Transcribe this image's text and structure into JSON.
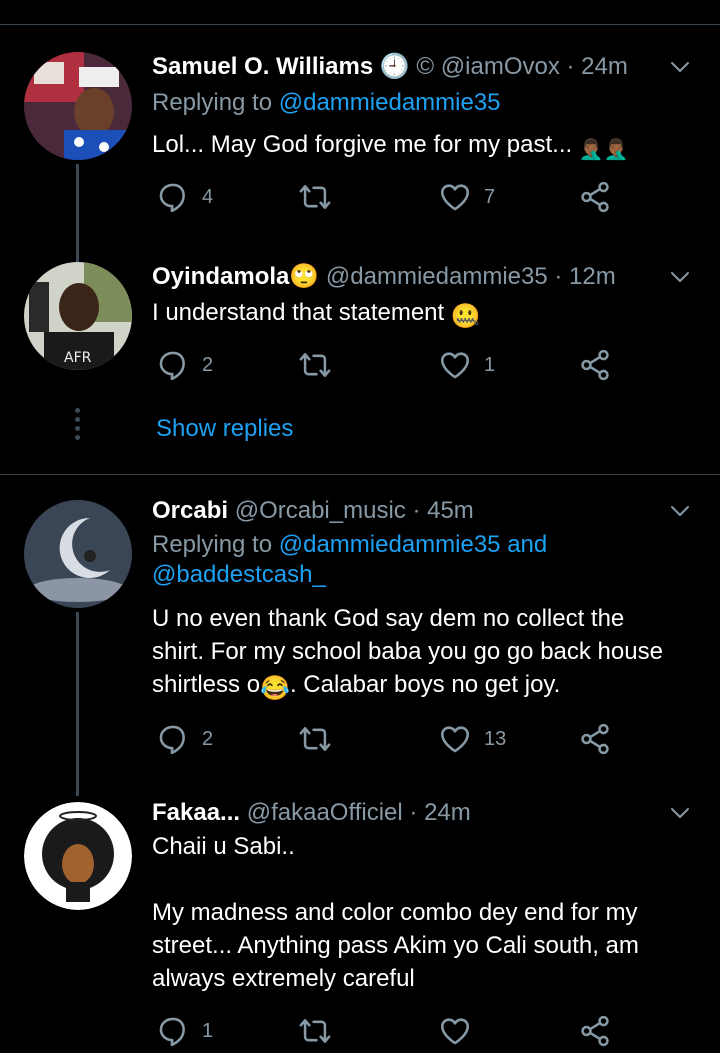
{
  "tweets": [
    {
      "name": "Samuel O. Williams",
      "name_suffix": "🕘 ©",
      "handle": "@iamOvox",
      "time": "· 24m",
      "replying_prefix": "Replying to ",
      "replying_to": "@dammiedammie35",
      "text": "Lol... May God forgive me for my past...",
      "text_emoji": "🤦🏾‍♂️🤦🏾‍♂️",
      "replies": "4",
      "retweets": "",
      "likes": "7"
    },
    {
      "name": "Oyindamola🙄",
      "handle": "@dammiedammie35",
      "time": "· 12m",
      "text": "I understand that statement",
      "text_emoji": "🤐",
      "replies": "2",
      "retweets": "",
      "likes": "1"
    },
    {
      "name": "Orcabi",
      "handle": "@Orcabi_music",
      "time": "· 45m",
      "replying_prefix": "Replying to ",
      "replying_to": "@dammiedammie35",
      "replying_and": " and",
      "replying_to_2": "@baddestcash_",
      "text_line1": "U no even thank God say dem no collect the",
      "text_line2": "shirt. For my school baba you go go back house",
      "text_line3a": "shirtless o",
      "text_line3_emoji": "😂",
      "text_line3b": ". Calabar boys no get joy.",
      "replies": "2",
      "retweets": "",
      "likes": "13"
    },
    {
      "name": "Fakaa...",
      "handle": "@fakaaOfficiel",
      "time": "· 24m",
      "text_line1": "Chaii u Sabi..",
      "text_line2": "My madness and color combo dey end for my",
      "text_line3": "street... Anything pass Akim yo Cali south, am",
      "text_line4": "always extremely careful",
      "replies": "1",
      "retweets": "",
      "likes": ""
    }
  ],
  "show_replies": "Show replies",
  "icons": {
    "reply": "reply-icon",
    "retweet": "retweet-icon",
    "like": "heart-icon",
    "share": "share-icon",
    "menu": "chevron-down-icon"
  },
  "colors": {
    "background": "#000000",
    "link": "#1da1f2",
    "muted": "#8899a6",
    "divider": "#38444d"
  }
}
